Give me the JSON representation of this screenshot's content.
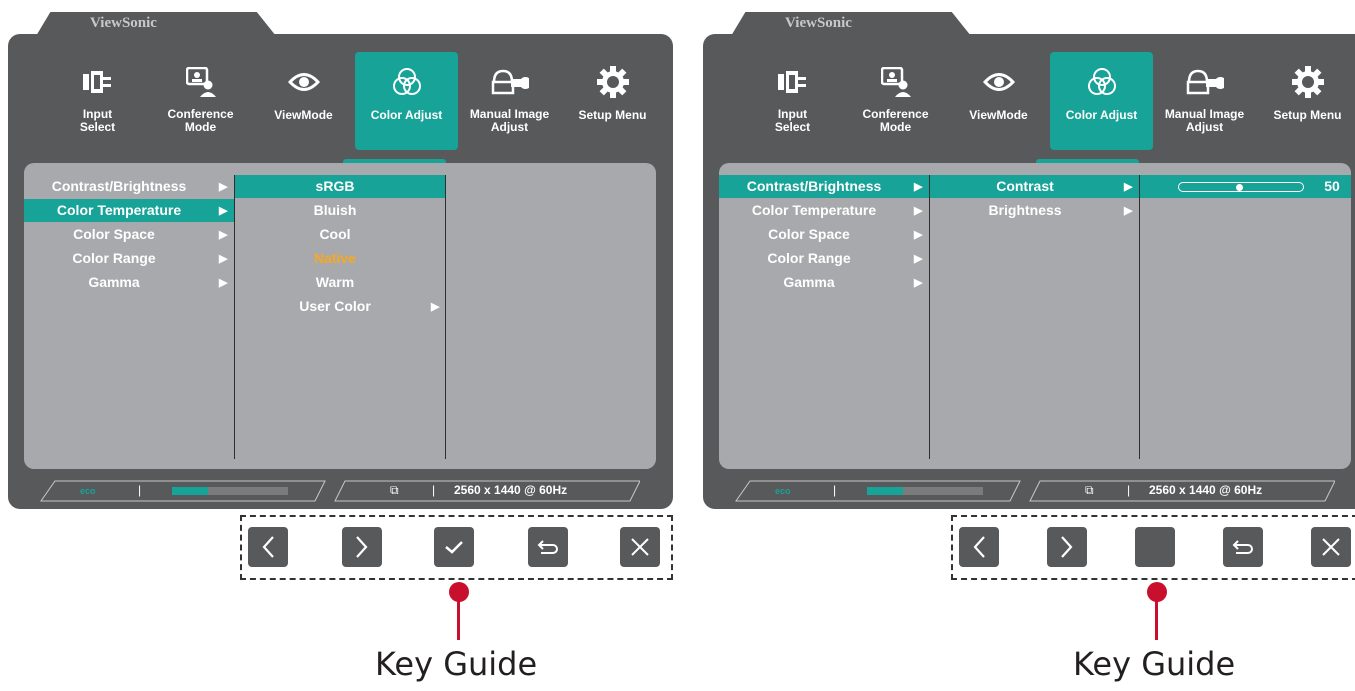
{
  "brand": "ViewSonic",
  "menu": [
    {
      "label": "Input\nSelect",
      "icon": "input-select-icon"
    },
    {
      "label": "Conference\nMode",
      "icon": "conference-mode-icon"
    },
    {
      "label": "ViewMode",
      "icon": "eye-icon"
    },
    {
      "label": "Color Adjust",
      "icon": "color-adjust-icon"
    },
    {
      "label": "Manual Image\nAdjust",
      "icon": "manual-image-adjust-icon"
    },
    {
      "label": "Setup Menu",
      "icon": "gear-icon"
    }
  ],
  "left": {
    "level1": [
      "Contrast/Brightness",
      "Color Temperature",
      "Color Space",
      "Color Range",
      "Gamma"
    ],
    "level2": [
      "sRGB",
      "Bluish",
      "Cool",
      "Native",
      "Warm",
      "User Color"
    ]
  },
  "right": {
    "level1": [
      "Contrast/Brightness",
      "Color Temperature",
      "Color Space",
      "Color Range",
      "Gamma"
    ],
    "level2": [
      "Contrast",
      "Brightness"
    ],
    "slider_value": "50",
    "slider_fraction": 0.5
  },
  "status": {
    "resolution": "2560 x 1440 @ 60Hz",
    "eco_label": "eco"
  },
  "key_guide": "Key Guide",
  "colors": {
    "accent": "#17a398",
    "panel": "#58595b",
    "content": "#a7a9ac",
    "highlight": "#f7a823",
    "pin": "#c8102e"
  }
}
